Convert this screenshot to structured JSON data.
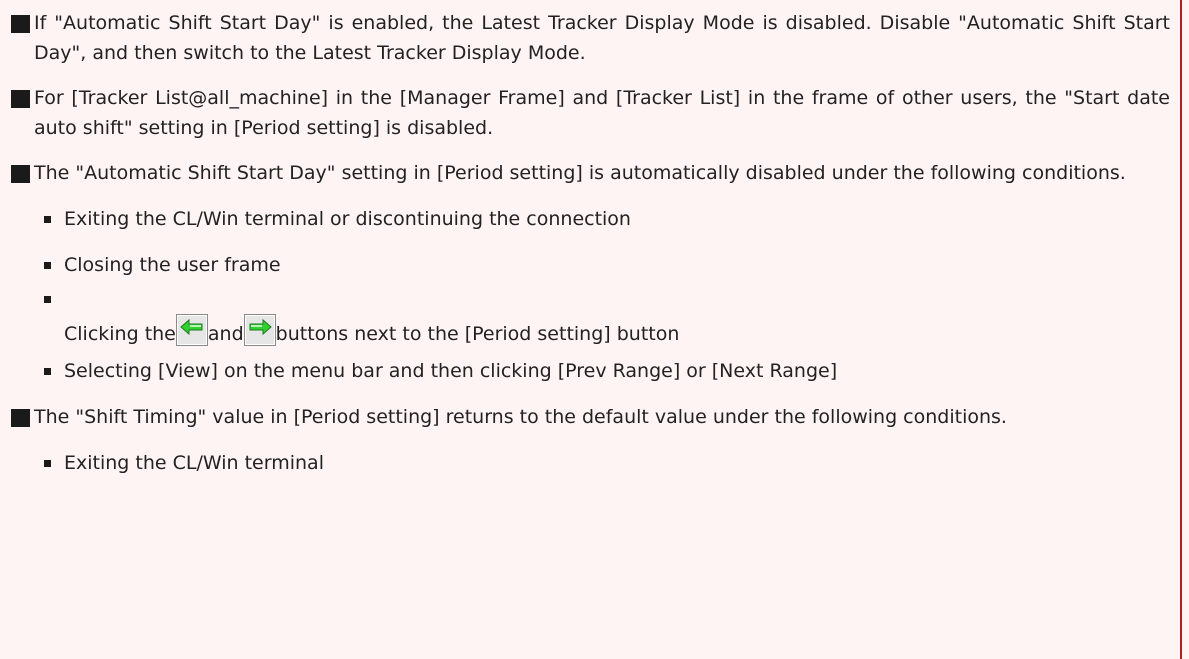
{
  "notes": [
    {
      "text": "If \"Automatic Shift Start Day\" is enabled, the Latest Tracker Display Mode is disabled. Disable \"Automatic Shift Start Day\", and then switch to the Latest Tracker Display Mode."
    },
    {
      "text": "For [Tracker List@all_machine] in the [Manager Frame] and [Tracker List] in the frame of other users, the \"Start date auto shift\" setting in [Period setting] is disabled."
    },
    {
      "text": "The \"Automatic Shift Start Day\" setting in [Period setting] is automatically disabled under the following conditions.",
      "bullets": [
        "Exiting the CL/Win terminal or discontinuing the connection",
        "Closing the user frame"
      ],
      "button_bullet": {
        "before": "Clicking the",
        "between": "and",
        "after": "buttons next to the [Period setting] button",
        "left_icon": "green-left-arrow-icon",
        "right_icon": "green-right-arrow-icon"
      },
      "bullets_after": [
        "Selecting [View] on the menu bar and then clicking [Prev Range] or [Next Range]"
      ]
    },
    {
      "text": "The \"Shift Timing\" value in [Period setting] returns to the default value under the following conditions.",
      "bullets": [
        "Exiting the CL/Win terminal"
      ]
    }
  ],
  "colors": {
    "background": "#fff4f4",
    "border": "#b02020",
    "arrow_green": "#2fd02f"
  }
}
